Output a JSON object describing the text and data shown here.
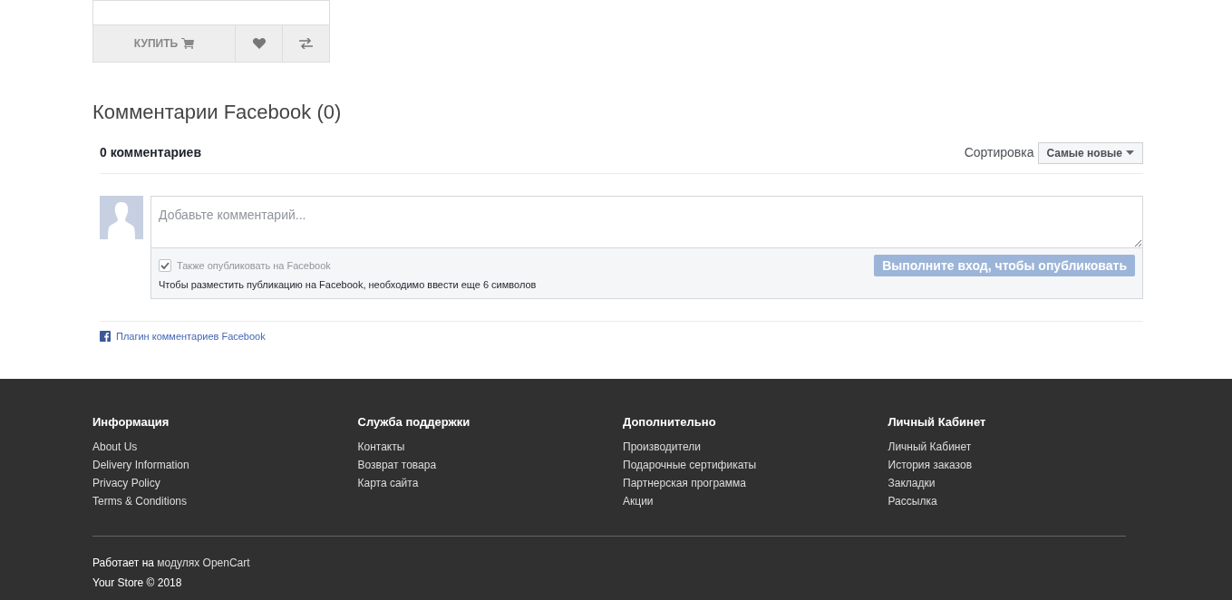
{
  "product_card": {
    "buy_label": "КУПИТЬ"
  },
  "comments": {
    "title": "Комментарии Facebook (0)",
    "count": "0 комментариев",
    "sort_label": "Сортировка",
    "sort_value": "Самые новые",
    "placeholder": "Добавьте комментарий...",
    "also_post": {
      "label": "Также опубликовать на Facebook",
      "checked": true
    },
    "hint": "Чтобы разместить публикацию на Facebook, необходимо ввести еще 6 символов",
    "submit": "Выполните вход, чтобы опубликовать",
    "plugin_link": "Плагин комментариев Facebook"
  },
  "footer": {
    "columns": [
      {
        "heading": "Информация",
        "links": [
          "About Us",
          "Delivery Information",
          "Privacy Policy",
          "Terms & Conditions"
        ]
      },
      {
        "heading": "Служба поддержки",
        "links": [
          "Контакты",
          "Возврат товара",
          "Карта сайта"
        ]
      },
      {
        "heading": "Дополнительно",
        "links": [
          "Производители",
          "Подарочные сертификаты",
          "Партнерская программа",
          "Акции"
        ]
      },
      {
        "heading": "Личный Кабинет",
        "links": [
          "Личный Кабинет",
          "История заказов",
          "Закладки",
          "Рассылка"
        ]
      }
    ],
    "powered": {
      "text": "Работает на",
      "link": "модулях OpenCart"
    },
    "copyright": "Your Store © 2018"
  }
}
